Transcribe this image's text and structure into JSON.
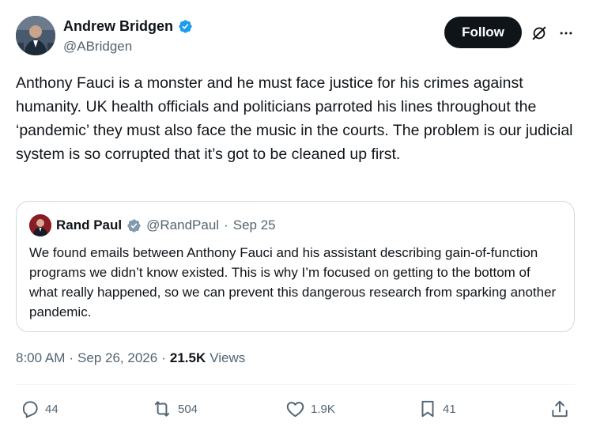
{
  "author": {
    "name": "Andrew Bridgen",
    "handle": "@ABridgen",
    "verified": true
  },
  "follow_label": "Follow",
  "tweet_text": "Anthony Fauci is a monster and he must face justice for his crimes against humanity. UK health officials and politicians parroted his lines throughout the ‘pandemic’ they must also face the music in the courts. The problem is our judicial system is so corrupted that it’s got to be cleaned up first.",
  "quote": {
    "name": "Rand Paul",
    "handle": "@RandPaul",
    "separator": "·",
    "date": "Sep 25",
    "text": "We found emails between Anthony Fauci and his assistant describing gain-of-function programs we didn’t know existed. This is why I’m focused on getting to the bottom of what really happened, so we can prevent this dangerous research from sparking another pandemic."
  },
  "meta": {
    "time": "8:00 AM",
    "sep1": "·",
    "date": "Sep 26, 2026",
    "sep2": "·",
    "views_count": "21.5K",
    "views_label": "Views"
  },
  "actions": {
    "replies": "44",
    "reposts": "504",
    "likes": "1.9K",
    "bookmarks": "41"
  },
  "colors": {
    "verified": "#1d9bf0",
    "verified_gray": "#829aab",
    "text": "#0f1419",
    "secondary": "#536471",
    "border": "#cfd9de"
  },
  "icons": [
    "verified-badge-icon",
    "grok-icon",
    "more-icon",
    "reply-icon",
    "repost-icon",
    "like-icon",
    "bookmark-icon",
    "share-icon"
  ]
}
